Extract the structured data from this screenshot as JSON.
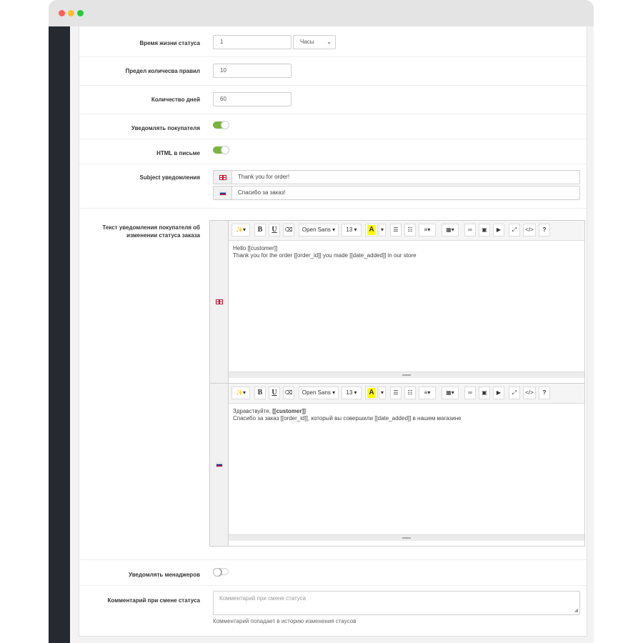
{
  "form": {
    "status_lifetime": {
      "label": "Время жизни статуса",
      "value": "1",
      "unit": "Часы"
    },
    "rules_limit": {
      "label": "Предел количесва правил",
      "value": "10"
    },
    "days_count": {
      "label": "Количество дней",
      "value": "60"
    },
    "notify_customer": {
      "label": "Уведомлять покупателя",
      "enabled": true
    },
    "html_in_email": {
      "label": "HTML в письме",
      "enabled": true
    },
    "subject": {
      "label": "Subject уведомления",
      "en_value": "Thank you for order!",
      "ru_value": "Спасибо за заказ!"
    },
    "notification_text": {
      "label_line1": "Текст уведомления покупателя об",
      "label_line2": "изменении статуса заказа",
      "en": {
        "line1": "Hello [[customer]]",
        "line2": "Thank you for the order [[order_id]] you made [[date_added]] in our store"
      },
      "ru": {
        "line1_prefix": "Здравствуйте, ",
        "line1_bold": "[[customer]]",
        "line2": "Спасибо за заказ [[order_id]], который вы совершили [[date_added]] в нашем магазине"
      }
    },
    "notify_managers": {
      "label": "Уведомлять менаджеров",
      "enabled": false
    },
    "status_comment": {
      "label": "Комментарий при смене статуса",
      "placeholder": "Комментарий при смене статуса",
      "help": "Комментарий попадает в историю изменения стаусов"
    }
  },
  "toolbar": {
    "magic": "✨▾",
    "bold": "B",
    "underline": "U",
    "eraser": "⌫",
    "font": "Open Sans ▾",
    "size": "13 ▾",
    "color": "A",
    "color_caret": "▾",
    "ul": "☰",
    "ol": "☷",
    "align": "≡▾",
    "table": "▦▾",
    "link": "∞",
    "image": "▣",
    "video": "▶",
    "fullscreen": "⤢",
    "code": "</>",
    "help": "?"
  }
}
